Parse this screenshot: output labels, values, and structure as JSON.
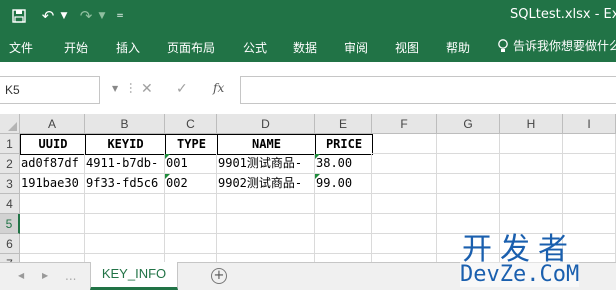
{
  "titlebar": {
    "save_icon": "floppy-disk-icon",
    "undo_icon": "undo-icon",
    "redo_icon": "redo-icon",
    "customize_icon": "customize-qat-icon",
    "title": "SQLtest.xlsx - Exc"
  },
  "ribbon": {
    "tabs": [
      "文件",
      "开始",
      "插入",
      "页面布局",
      "公式",
      "数据",
      "审阅",
      "视图",
      "帮助"
    ],
    "tell_me_icon": "lightbulb-icon",
    "tell_me": "告诉我你想要做什么"
  },
  "formula_bar": {
    "name_box": "K5",
    "cancel_icon": "cross-icon",
    "enter_icon": "check-icon",
    "function_icon": "fx-icon",
    "fx_label": "fx",
    "formula": ""
  },
  "grid": {
    "columns": [
      "A",
      "B",
      "C",
      "D",
      "E",
      "F",
      "G",
      "H",
      "I"
    ],
    "rows": [
      "1",
      "2",
      "3",
      "4",
      "5",
      "6",
      "7"
    ],
    "selected_row": "5",
    "header": [
      "UUID",
      "KEYID",
      "TYPE",
      "NAME",
      "PRICE"
    ],
    "data": [
      [
        "ad0f87df",
        "4911-b7db-",
        "001",
        "9901测试商品-",
        "38.00"
      ],
      [
        "191bae30",
        "9f33-fd5c6",
        "002",
        "9902测试商品-",
        "99.00"
      ]
    ]
  },
  "sheet_tabs": {
    "tabs": [
      "KEY_INFO"
    ],
    "active": "KEY_INFO",
    "add_icon": "plus-circle-icon",
    "prev_icon": "triangle-left-icon",
    "next_icon": "triangle-right-icon",
    "more": "..."
  },
  "watermark": {
    "top": "开发者",
    "bottom": "DevZe.CoM"
  },
  "colors": {
    "accent": "#217346",
    "error_triangle": "#1d8a3a",
    "watermark": "#1a5fae"
  }
}
